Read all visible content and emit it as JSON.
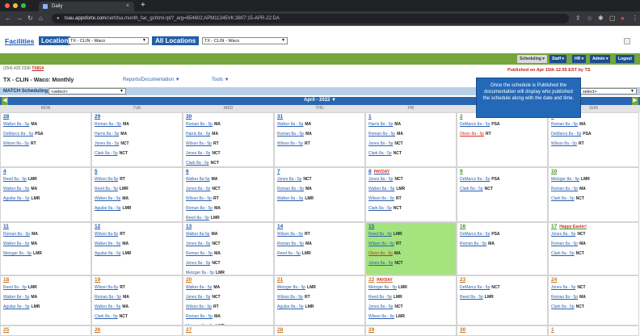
{
  "browser": {
    "tab_title": "Daily",
    "url_host": "tsau.appsforte.com",
    "url_path": "/cert/tsa.month_fac_gchtml.rpt?_arg=654602;APM11345VK:3807:15-APR-22:DA",
    "new_tab": "+",
    "close_tab": "×"
  },
  "header": {
    "facilities_label": "Facilities",
    "location_label": "Location",
    "location_value": "TX - CLIN - Waco",
    "all_locations_label": "All Locations",
    "all_locations_value": "TX - CLIN - Waco",
    "phone": "(254) 420 2336",
    "phone_link": "TX814",
    "menus": [
      "Scheduling",
      "Staff",
      "HR",
      "Admin",
      "Logout"
    ],
    "published_text": "Published on Apr 15th 12:55 EST by TS"
  },
  "page": {
    "title": "TX - CLIN - Waco: Monthly",
    "reports_menu": "Reports/Documentation ▼",
    "tools_menu": "Tools ▼",
    "match_label": "MATCH Scheduling",
    "match_select": "<select>",
    "right_select": "select>",
    "tooltip": "Once the schedule is Published the documentation will display who published the schedule along with the date and time."
  },
  "calendar": {
    "month": "April - 2022 ▼",
    "days": [
      "MON",
      "TUE",
      "WED",
      "THU",
      "FRI",
      "SAT",
      "SUN"
    ],
    "weeks": [
      [
        {
          "d": "28",
          "e": [
            [
              "Walker 8a - 5p",
              "MA"
            ],
            [
              "DeMarco 8a - 5p",
              "PSA"
            ],
            [
              "Wilson 8a - 5p",
              "RT"
            ]
          ]
        },
        {
          "d": "29",
          "e": [
            [
              "Roman 8a - 5p",
              "MA"
            ],
            [
              "Harris 8a - 5p",
              "MA"
            ],
            [
              "Jones 8a - 5p",
              "NCT"
            ],
            [
              "Clark 8a - 5p",
              "NCT"
            ]
          ]
        },
        {
          "d": "30",
          "e": [
            [
              "Roman 8a - 5p",
              "MA"
            ],
            [
              "Harris 8a - 5p",
              "MA"
            ],
            [
              "Wilson 8a - 5p",
              "RT"
            ],
            [
              "Jones 8a - 5p",
              "NCT"
            ],
            [
              "Clark 8a - 5p",
              "NCT"
            ]
          ]
        },
        {
          "d": "31",
          "e": [
            [
              "Walker 8a - 5p",
              "MA"
            ],
            [
              "Roman 8a - 5p",
              "MA"
            ],
            [
              "Wilson 8a - 5p",
              "RT"
            ]
          ]
        },
        {
          "d": "1",
          "e": [
            [
              "Harris 8a - 5p",
              "MA"
            ],
            [
              "Roman 8a - 5p",
              "MA"
            ],
            [
              "Jones 8a - 5p",
              "NCT"
            ],
            [
              "Clark 8a - 5p",
              "NCT"
            ]
          ]
        },
        {
          "d": "2",
          "e": [
            [
              "DeMarco 8a - 5p",
              "PSA"
            ],
            [
              "Olson 8a - 5p",
              "RT"
            ]
          ]
        },
        {
          "d": "3",
          "e": [
            [
              "Roman 8a - 5p",
              "MA"
            ],
            [
              "DeMarco 8a - 5p",
              "PSA"
            ],
            [
              "Wilson 8a - 5p",
              "RT"
            ]
          ]
        }
      ],
      [
        {
          "d": "4",
          "e": [
            [
              "Reed 8a - 5p",
              "LMR"
            ],
            [
              "Walker 8a - 5p",
              "MA"
            ],
            [
              "Aguilar 8a - 5p",
              "LMR"
            ]
          ]
        },
        {
          "d": "5",
          "e": [
            [
              "Wilson 8a-5p",
              "RT"
            ],
            [
              "Reed 8a - 5p",
              "LMR"
            ],
            [
              "Walker 8a - 5p",
              "MA"
            ],
            [
              "Aguilar 8a - 5p",
              "LMR"
            ]
          ]
        },
        {
          "d": "6",
          "e": [
            [
              "Walker 8a-5p",
              "MA"
            ],
            [
              "Jones 8a - 5p",
              "NCT"
            ],
            [
              "Wilson 8a - 5p",
              "RT"
            ],
            [
              "Roman 8a - 5p",
              "MA"
            ],
            [
              "Reed 8a - 5p",
              "LMR"
            ]
          ]
        },
        {
          "d": "7",
          "e": [
            [
              "Jones 8a - 5p",
              "NCT"
            ],
            [
              "Roman 8a - 5p",
              "MA"
            ],
            [
              "Walker 8a - 5p",
              "LMR"
            ]
          ]
        },
        {
          "d": "8",
          "badge": "PAYDAY",
          "e": [
            [
              "Jones 8a - 5p",
              "NCT"
            ],
            [
              "Walker 8a - 5p",
              "LMR"
            ],
            [
              "Wilson 8a - 5p",
              "RT"
            ],
            [
              "Clark 8a - 5p",
              "NCT"
            ]
          ]
        },
        {
          "d": "9",
          "e": [
            [
              "DeMarco 8a - 5p",
              "PSA"
            ],
            [
              "Clark 8a - 5p",
              "NCT"
            ]
          ]
        },
        {
          "d": "10",
          "e": [
            [
              "Metzger 8a - 5p",
              "LMR"
            ],
            [
              "Roman 8a - 5p",
              "MA"
            ],
            [
              "Clark 8a - 5p",
              "NCT"
            ]
          ]
        }
      ],
      [
        {
          "d": "11",
          "e": [
            [
              "Roman 8a - 5p",
              "MA"
            ],
            [
              "Walker 8a - 5p",
              "MA"
            ],
            [
              "Metzger 8a - 5p",
              "LMR"
            ]
          ]
        },
        {
          "d": "12",
          "e": [
            [
              "Wilson 8a-5p",
              "RT"
            ],
            [
              "Walker 8a - 5p",
              "MA"
            ],
            [
              "Aguilar 8a - 5p",
              "LMR"
            ]
          ]
        },
        {
          "d": "13",
          "e": [
            [
              "Walker 8a-5p",
              "MA"
            ],
            [
              "Jones 8a - 5p",
              "NCT"
            ],
            [
              "Roman 8a - 5p",
              "MA"
            ],
            [
              "Jones 8a - 5p",
              "NCT"
            ],
            [
              "Metzger 8a - 5p",
              "LMR"
            ]
          ]
        },
        {
          "d": "14",
          "e": [
            [
              "Wilson 8a - 5p",
              "RT"
            ],
            [
              "Roman 8a - 5p",
              "MA"
            ],
            [
              "Reed 8a - 5p",
              "LMR"
            ]
          ]
        },
        {
          "d": "15",
          "hl": true,
          "e": [
            [
              "Reed 8a - 5p",
              "LMR"
            ],
            [
              "Wilson 8a - 5p",
              "RT"
            ],
            [
              "Olson 8a - 5p",
              "MA"
            ],
            [
              "Jones 8a - 5p",
              "NCT"
            ]
          ]
        },
        {
          "d": "16",
          "e": [
            [
              "DeMarco 8a - 5p",
              "PSA"
            ],
            [
              "Roman 8a - 5p",
              "MA"
            ]
          ]
        },
        {
          "d": "17",
          "badge": "Happy Easter!",
          "e": [
            [
              "Jones 8a - 5p",
              "NCT"
            ],
            [
              "Roman 8a - 5p",
              "MA"
            ],
            [
              "Clark 8a - 5p",
              "NCT"
            ]
          ]
        }
      ],
      [
        {
          "d": "18",
          "e": [
            [
              "Reed 8a - 5p",
              "LMR"
            ],
            [
              "Walker 8a - 5p",
              "MA"
            ],
            [
              "Aguilar 8a - 5p",
              "LMR"
            ]
          ]
        },
        {
          "d": "19",
          "e": [
            [
              "Wilson 8a-5p",
              "RT"
            ],
            [
              "Roman 8a - 5p",
              "MA"
            ],
            [
              "Walker 8a - 5p",
              "MA"
            ],
            [
              "Clark 8a - 5p",
              "NCT"
            ]
          ]
        },
        {
          "d": "20",
          "e": [
            [
              "Walker 8a - 5p",
              "MA"
            ],
            [
              "Jones 8a - 5p",
              "NCT"
            ],
            [
              "Wilson 8a - 5p",
              "RT"
            ],
            [
              "Roman 8a - 5p",
              "MA"
            ],
            [
              "Metzger 8a - 5p",
              "LMR"
            ]
          ]
        },
        {
          "d": "21",
          "e": [
            [
              "Metzger 8a - 5p",
              "LMR"
            ],
            [
              "Wilson 8a - 5p",
              "RT"
            ],
            [
              "Aguilar 8a - 5p",
              "LMR"
            ]
          ]
        },
        {
          "d": "22",
          "badge": "PAYDAY",
          "e": [
            [
              "Metzger 8a - 5p",
              "LMR"
            ],
            [
              "Reed 8a - 5p",
              "LMR"
            ],
            [
              "Jones 8a - 5p",
              "NCT"
            ],
            [
              "Wilson 8a - 5p",
              "LMR"
            ]
          ]
        },
        {
          "d": "23",
          "e": [
            [
              "DeMarco 8a - 5p",
              "NCT"
            ],
            [
              "Reed 8a - 5p",
              "LMR"
            ]
          ]
        },
        {
          "d": "24",
          "e": [
            [
              "Jones 8a - 5p",
              "NCT"
            ],
            [
              "Roman 8a - 5p",
              "MA"
            ],
            [
              "Clark 8a - 5p",
              "NCT"
            ]
          ]
        }
      ],
      [
        {
          "d": "25",
          "e": []
        },
        {
          "d": "26",
          "e": []
        },
        {
          "d": "27",
          "e": []
        },
        {
          "d": "28",
          "e": []
        },
        {
          "d": "29",
          "e": []
        },
        {
          "d": "30",
          "e": []
        },
        {
          "d": "1",
          "e": []
        }
      ]
    ]
  },
  "colors": {
    "header_blue": "#1f5fa9",
    "green_bar": "#74a53e",
    "today_cell": "#a4e37e",
    "alert_red": "#c0221f"
  }
}
